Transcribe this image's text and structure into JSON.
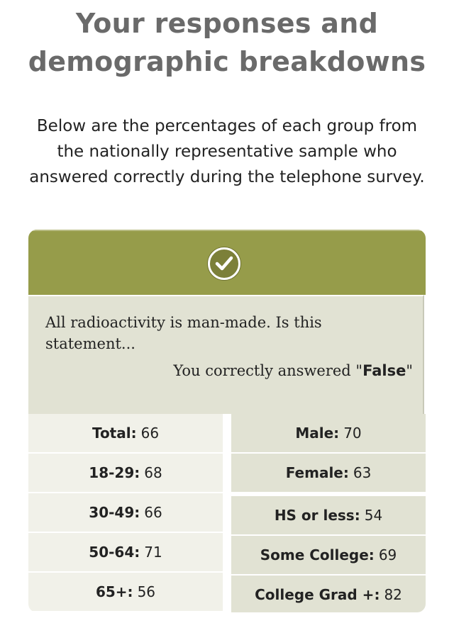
{
  "title": {
    "line1": "Your responses and",
    "line2": "demographic breakdowns"
  },
  "intro": "Below are the percentages of each group from the nationally representative sample who answered correctly during the telephone survey.",
  "card": {
    "header_icon": "check-circle-icon",
    "accent_color": "#969c4a",
    "question": "All radioactivity is man-made. Is this statement...",
    "answer_prefix": "You correctly answered \"",
    "answer_value": "False",
    "answer_suffix": "\""
  },
  "breakdown": {
    "left": [
      {
        "label": "Total:",
        "value": "66"
      },
      {
        "label": "18-29:",
        "value": "68"
      },
      {
        "label": "30-49:",
        "value": "66"
      },
      {
        "label": "50-64:",
        "value": "71"
      },
      {
        "label": "65+:",
        "value": "56"
      }
    ],
    "right": [
      {
        "label": "Male:",
        "value": "70"
      },
      {
        "label": "Female:",
        "value": "63"
      },
      {
        "label": "HS or less:",
        "value": "54"
      },
      {
        "label": "Some College:",
        "value": "69"
      },
      {
        "label": "College Grad +:",
        "value": "82"
      }
    ]
  }
}
